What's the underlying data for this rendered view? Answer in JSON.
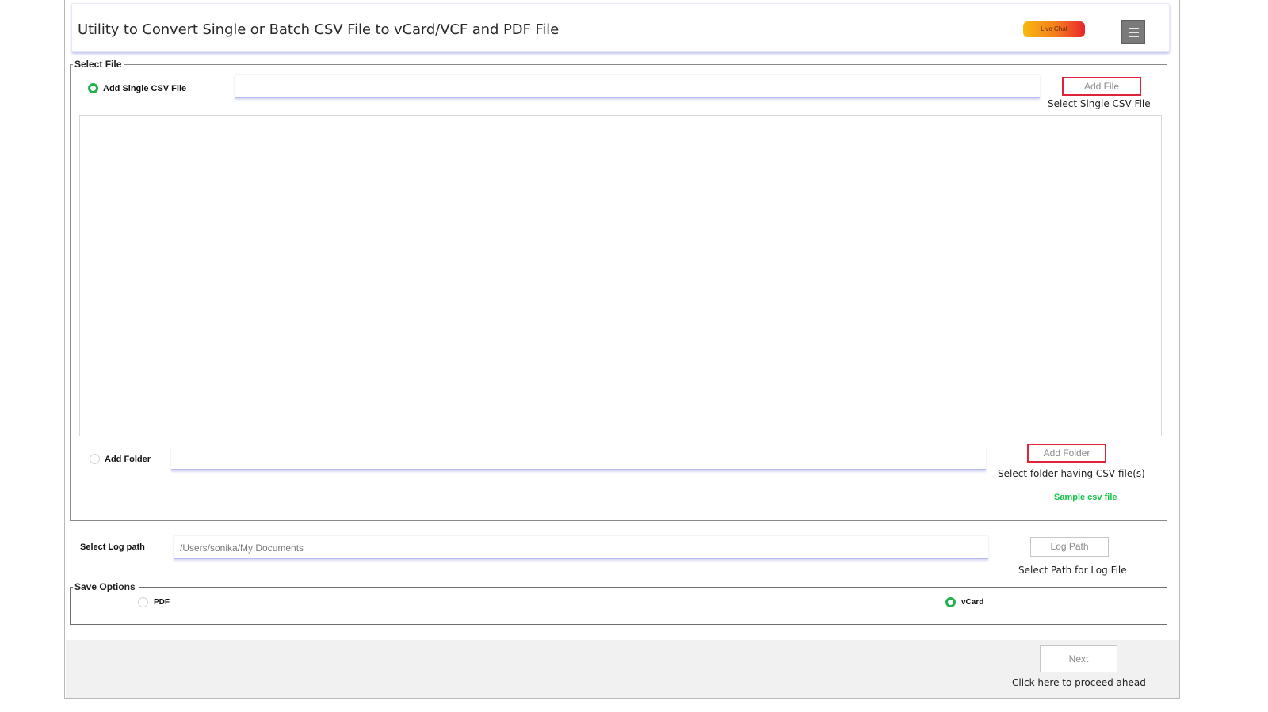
{
  "header": {
    "title": "Utility to Convert Single or Batch CSV File to vCard/VCF and PDF File",
    "live_chat_label": "Live Chat",
    "menu_icon": "hamburger-menu-icon"
  },
  "select_file": {
    "legend": "Select File",
    "single": {
      "label": "Add Single CSV File",
      "selected": true,
      "value": "",
      "button_label": "Add File",
      "hint": "Select Single CSV File"
    },
    "folder": {
      "label": "Add Folder",
      "selected": false,
      "value": "",
      "button_label": "Add Folder",
      "hint": "Select folder having CSV file(s)"
    },
    "sample_link": "Sample csv file"
  },
  "log": {
    "label": "Select Log path",
    "value": "/Users/sonika/My Documents",
    "button_label": "Log Path",
    "hint": "Select Path for Log File"
  },
  "save_options": {
    "legend": "Save Options",
    "options": [
      {
        "label": "PDF",
        "selected": false
      },
      {
        "label": "vCard",
        "selected": true
      }
    ]
  },
  "footer": {
    "next_label": "Next",
    "hint": "Click here to proceed ahead"
  },
  "colors": {
    "accent_green": "#22b14c",
    "button_red": "#e0223a",
    "field_underline": "#b8bcee"
  }
}
